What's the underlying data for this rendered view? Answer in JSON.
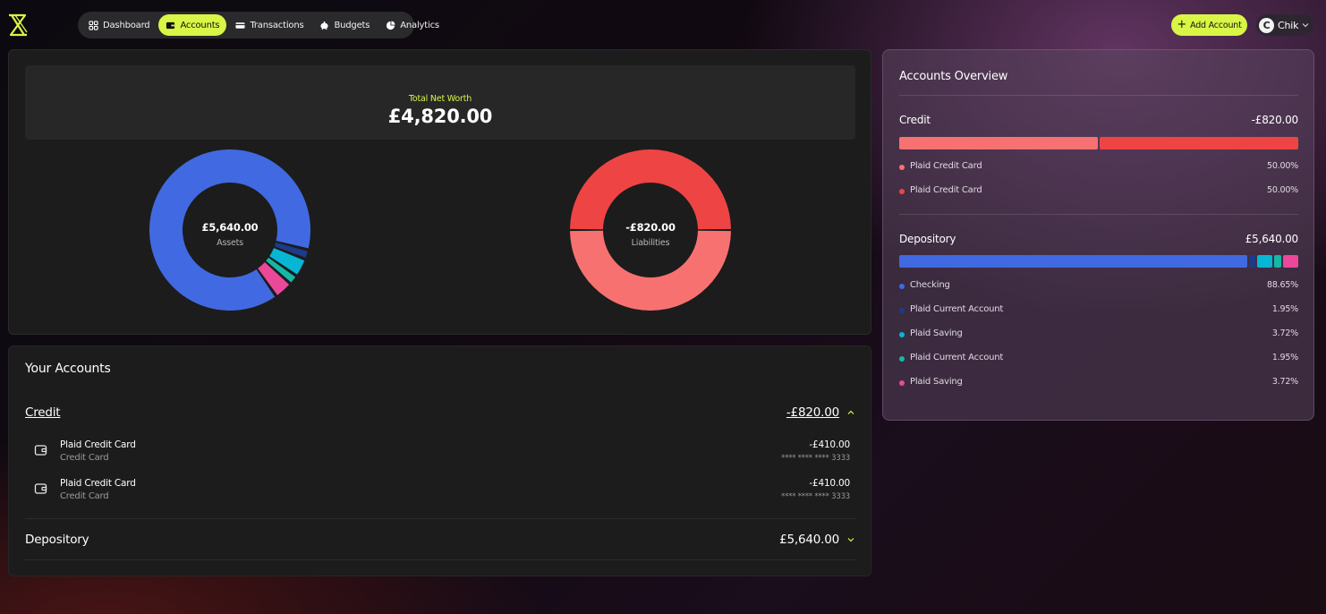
{
  "nav": {
    "items": [
      {
        "label": "Dashboard",
        "icon": "grid-icon"
      },
      {
        "label": "Accounts",
        "icon": "wallet-icon",
        "active": true
      },
      {
        "label": "Transactions",
        "icon": "card-icon"
      },
      {
        "label": "Budgets",
        "icon": "piggy-bank-icon"
      },
      {
        "label": "Analytics",
        "icon": "pie-chart-icon"
      }
    ]
  },
  "header": {
    "add_account_label": "Add Account",
    "user_initial": "C",
    "user_name": "Chik"
  },
  "summary": {
    "net_worth_label": "Total Net Worth",
    "net_worth_value": "£4,820.00",
    "assets_value": "£5,640.00",
    "assets_label": "Assets",
    "liabilities_value": "-£820.00",
    "liabilities_label": "Liabilities"
  },
  "chart_data": [
    {
      "type": "pie",
      "title": "",
      "center_text": "£5,640.00",
      "series": [
        {
          "name": "Checking",
          "value": 88.65,
          "color": "#4169e1"
        },
        {
          "name": "Plaid Current Account",
          "value": 1.95,
          "color": "#1e3a8a"
        },
        {
          "name": "Plaid Saving",
          "value": 3.72,
          "color": "#06b6d4"
        },
        {
          "name": "Plaid Current Account",
          "value": 1.95,
          "color": "#14b8a6"
        },
        {
          "name": "Plaid Saving",
          "value": 3.72,
          "color": "#ec4899"
        }
      ]
    },
    {
      "type": "pie",
      "title": "",
      "center_text": "-£820.00",
      "series": [
        {
          "name": "Plaid Credit Card",
          "value": 50.0,
          "color": "#f87171"
        },
        {
          "name": "Plaid Credit Card",
          "value": 50.0,
          "color": "#ef4444"
        }
      ]
    }
  ],
  "accounts": {
    "title": "Your Accounts",
    "credit": {
      "name": "Credit",
      "total": "-£820.00",
      "items": [
        {
          "name": "Plaid Credit Card",
          "type": "Credit Card",
          "amount": "-£410.00",
          "mask": "**** **** **** 3333"
        },
        {
          "name": "Plaid Credit Card",
          "type": "Credit Card",
          "amount": "-£410.00",
          "mask": "**** **** **** 3333"
        }
      ]
    },
    "depository": {
      "name": "Depository",
      "total": "£5,640.00"
    }
  },
  "overview": {
    "title": "Accounts Overview",
    "credit": {
      "name": "Credit",
      "total": "-£820.00",
      "items": [
        {
          "name": "Plaid Credit Card",
          "pct": "50.00%",
          "color": "#f87171"
        },
        {
          "name": "Plaid Credit Card",
          "pct": "50.00%",
          "color": "#ef4444"
        }
      ]
    },
    "depository": {
      "name": "Depository",
      "total": "£5,640.00",
      "items": [
        {
          "name": "Checking",
          "pct": "88.65%",
          "color": "#4169e1"
        },
        {
          "name": "Plaid Current Account",
          "pct": "1.95%",
          "color": "#1e3a8a"
        },
        {
          "name": "Plaid Saving",
          "pct": "3.72%",
          "color": "#06b6d4"
        },
        {
          "name": "Plaid Current Account",
          "pct": "1.95%",
          "color": "#14b8a6"
        },
        {
          "name": "Plaid Saving",
          "pct": "3.72%",
          "color": "#ec4899"
        }
      ]
    }
  }
}
